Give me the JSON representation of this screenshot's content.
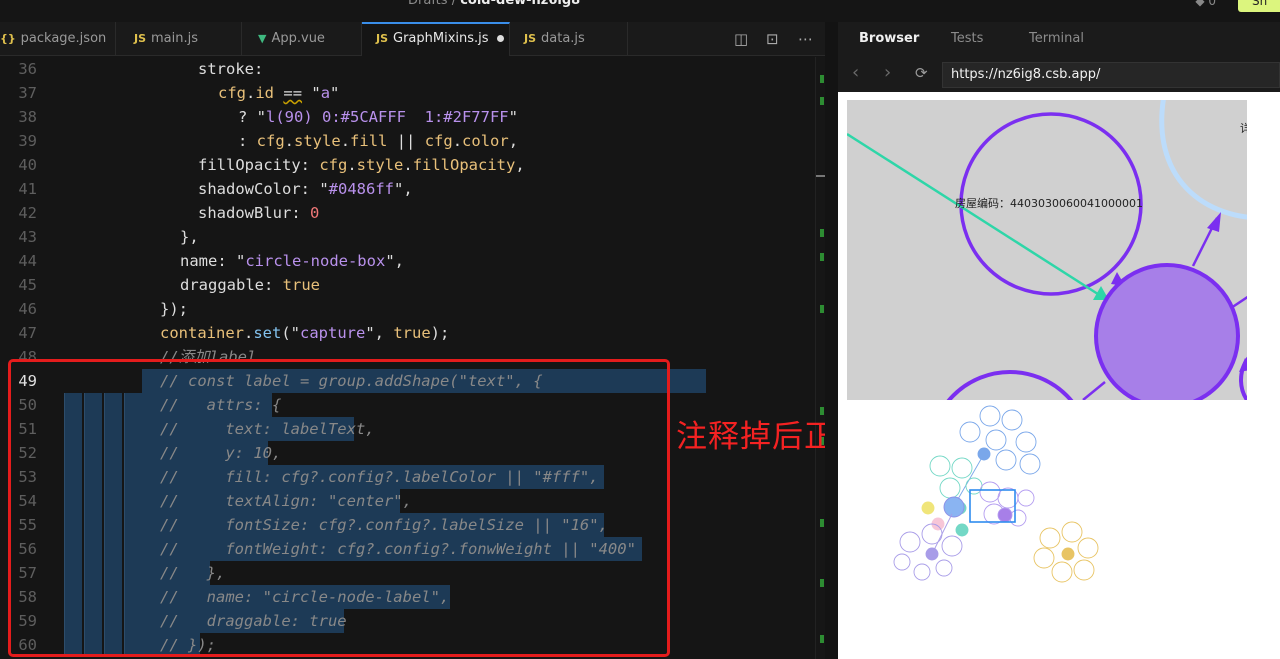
{
  "topbar": {
    "breadcrumb_root": "Drafts",
    "breadcrumb_sep": "/",
    "breadcrumb_project": "cold-dew-nz6ig8",
    "count": "0",
    "share_label": "Sh"
  },
  "editor": {
    "tabs": [
      {
        "icon": "{}",
        "icon_color": "#e0c14d",
        "label": "package.json",
        "active": false
      },
      {
        "icon": "JS",
        "icon_color": "#e0c14d",
        "label": "main.js",
        "active": false
      },
      {
        "icon": "▼",
        "icon_color": "#3fb980",
        "label": "App.vue",
        "active": false
      },
      {
        "icon": "JS",
        "icon_color": "#e0c14d",
        "label": "GraphMixins.js",
        "active": true,
        "modified": true
      },
      {
        "icon": "JS",
        "icon_color": "#e0c14d",
        "label": "data.js",
        "active": false
      }
    ],
    "lines": [
      {
        "n": "36",
        "indent": 196,
        "tokens": [
          [
            "stroke:",
            "p"
          ]
        ]
      },
      {
        "n": "37",
        "indent": 216,
        "tokens": [
          [
            "cfg",
            "k"
          ],
          [
            ".",
            "p"
          ],
          [
            "id",
            "k"
          ],
          [
            " ",
            "p"
          ],
          [
            "==",
            "sq"
          ],
          [
            " \"",
            "p"
          ],
          [
            "a",
            "s"
          ],
          [
            "\"",
            "p"
          ]
        ]
      },
      {
        "n": "38",
        "indent": 236,
        "tokens": [
          [
            "? \"",
            "p"
          ],
          [
            "l(90) 0:#5CAFFF  1:#2F77FF",
            "s"
          ],
          [
            "\"",
            "p"
          ]
        ]
      },
      {
        "n": "39",
        "indent": 236,
        "tokens": [
          [
            ": ",
            "p"
          ],
          [
            "cfg",
            "k"
          ],
          [
            ".",
            "p"
          ],
          [
            "style",
            "k"
          ],
          [
            ".",
            "p"
          ],
          [
            "fill",
            "k"
          ],
          [
            " || ",
            "p"
          ],
          [
            "cfg",
            "k"
          ],
          [
            ".",
            "p"
          ],
          [
            "color",
            "k"
          ],
          [
            ",",
            "p"
          ]
        ]
      },
      {
        "n": "40",
        "indent": 196,
        "tokens": [
          [
            "fillOpacity: ",
            "p"
          ],
          [
            "cfg",
            "k"
          ],
          [
            ".",
            "p"
          ],
          [
            "style",
            "k"
          ],
          [
            ".",
            "p"
          ],
          [
            "fillOpacity",
            "k"
          ],
          [
            ",",
            "p"
          ]
        ]
      },
      {
        "n": "41",
        "indent": 196,
        "tokens": [
          [
            "shadowColor: \"",
            "p"
          ],
          [
            "#0486ff",
            "s"
          ],
          [
            "\",",
            "p"
          ]
        ]
      },
      {
        "n": "42",
        "indent": 196,
        "tokens": [
          [
            "shadowBlur: ",
            "p"
          ],
          [
            "0",
            "n"
          ]
        ]
      },
      {
        "n": "43",
        "indent": 178,
        "tokens": [
          [
            "},",
            "p"
          ]
        ]
      },
      {
        "n": "44",
        "indent": 178,
        "tokens": [
          [
            "name: \"",
            "p"
          ],
          [
            "circle-node-box",
            "s"
          ],
          [
            "\",",
            "p"
          ]
        ]
      },
      {
        "n": "45",
        "indent": 178,
        "tokens": [
          [
            "draggable: ",
            "p"
          ],
          [
            "true",
            "k"
          ]
        ]
      },
      {
        "n": "46",
        "indent": 158,
        "tokens": [
          [
            "});",
            "p"
          ]
        ]
      },
      {
        "n": "47",
        "indent": 158,
        "tokens": [
          [
            "container",
            "k"
          ],
          [
            ".",
            "p"
          ],
          [
            "set",
            "f"
          ],
          [
            "(\"",
            "p"
          ],
          [
            "capture",
            "s"
          ],
          [
            "\", ",
            "p"
          ],
          [
            "true",
            "k"
          ],
          [
            ");",
            "p"
          ]
        ]
      },
      {
        "n": "48",
        "indent": 158,
        "tokens": [
          [
            "//添加label",
            "c"
          ]
        ]
      },
      {
        "n": "49",
        "indent": 158,
        "tokens": [
          [
            "// const label = group.addShape(\"text\", {",
            "c"
          ]
        ]
      },
      {
        "n": "50",
        "indent": 158,
        "tokens": [
          [
            "//   attrs: {",
            "c"
          ]
        ]
      },
      {
        "n": "51",
        "indent": 158,
        "tokens": [
          [
            "//     text: labelText,",
            "c"
          ]
        ]
      },
      {
        "n": "52",
        "indent": 158,
        "tokens": [
          [
            "//     y: 10,",
            "c"
          ]
        ]
      },
      {
        "n": "53",
        "indent": 158,
        "tokens": [
          [
            "//     fill: cfg?.config?.labelColor || \"#fff\",",
            "c"
          ]
        ]
      },
      {
        "n": "54",
        "indent": 158,
        "tokens": [
          [
            "//     textAlign: \"center\",",
            "c"
          ]
        ]
      },
      {
        "n": "55",
        "indent": 158,
        "tokens": [
          [
            "//     fontSize: cfg?.config?.labelSize || \"16\",",
            "c"
          ]
        ]
      },
      {
        "n": "56",
        "indent": 158,
        "tokens": [
          [
            "//     fontWeight: cfg?.config?.fonwWeight || \"400\"",
            "c"
          ]
        ]
      },
      {
        "n": "57",
        "indent": 158,
        "tokens": [
          [
            "//   },",
            "c"
          ]
        ]
      },
      {
        "n": "58",
        "indent": 158,
        "tokens": [
          [
            "//   name: \"circle-node-label\",",
            "c"
          ]
        ]
      },
      {
        "n": "59",
        "indent": 158,
        "tokens": [
          [
            "//   draggable: true",
            "c"
          ]
        ]
      },
      {
        "n": "60",
        "indent": 158,
        "tokens": [
          [
            "// });",
            "c"
          ]
        ]
      }
    ],
    "current_line": "49"
  },
  "annotation": {
    "text": "注释掉后正常",
    "color": "#f42222"
  },
  "browser": {
    "tabs": [
      "Browser",
      "Tests",
      "Terminal"
    ],
    "active_tab": "Browser",
    "url": "https://nz6ig8.csb.app/",
    "graph_label": "房屋编码：4403030060041000001",
    "graph_edge_label_fragment": "详"
  },
  "colors": {
    "node_stroke": "#7b2ff0",
    "node_fill": "#a77fe8",
    "edge_teal": "#2ed6a8",
    "canvas_bg": "#d0d0d0",
    "light_ring": "#bcdcfb",
    "highlight_box": "#2f8cef"
  }
}
